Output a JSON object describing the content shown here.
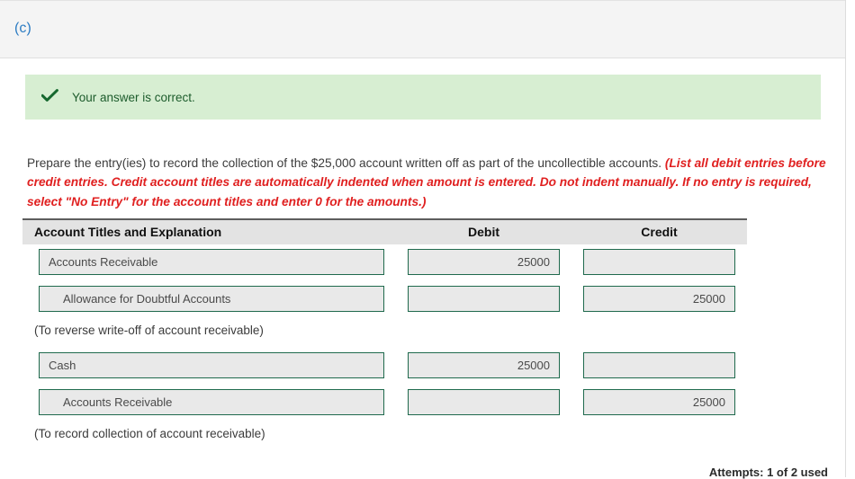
{
  "panel": {
    "part_label": "(c)",
    "accent_color": "#2c7cc3"
  },
  "alert": {
    "icon": "check-icon",
    "message": "Your answer is correct.",
    "background_color": "#d7eed2",
    "text_color": "#1d5c2c"
  },
  "instructions": {
    "normal_text": "Prepare the entry(ies) to record the collection of the $25,000 account written off as part of the uncollectible accounts. ",
    "requirement_text": "(List all debit entries before credit entries. Credit account titles are automatically indented when amount is entered. Do not indent manually. If no entry is required, select \"No Entry\" for the account titles and enter 0 for the amounts.)",
    "requirement_color": "#e02020"
  },
  "journal": {
    "headers": {
      "accounts": "Account Titles and Explanation",
      "debit": "Debit",
      "credit": "Credit"
    },
    "field_border_color": "#1f6a4d",
    "field_background_color": "#e9e9e9",
    "rows": [
      {
        "type": "entry",
        "account": "Accounts Receivable",
        "indented": false,
        "debit": "25000",
        "credit": ""
      },
      {
        "type": "entry",
        "account": "Allowance for Doubtful Accounts",
        "indented": true,
        "debit": "",
        "credit": "25000"
      },
      {
        "type": "note",
        "text": "(To reverse write-off of account receivable)"
      },
      {
        "type": "entry",
        "account": "Cash",
        "indented": false,
        "debit": "25000",
        "credit": ""
      },
      {
        "type": "entry",
        "account": "Accounts Receivable",
        "indented": true,
        "debit": "",
        "credit": "25000"
      },
      {
        "type": "note",
        "text": "(To record collection of account receivable)"
      }
    ]
  },
  "footer": {
    "attempts": "Attempts: 1 of 2 used"
  }
}
